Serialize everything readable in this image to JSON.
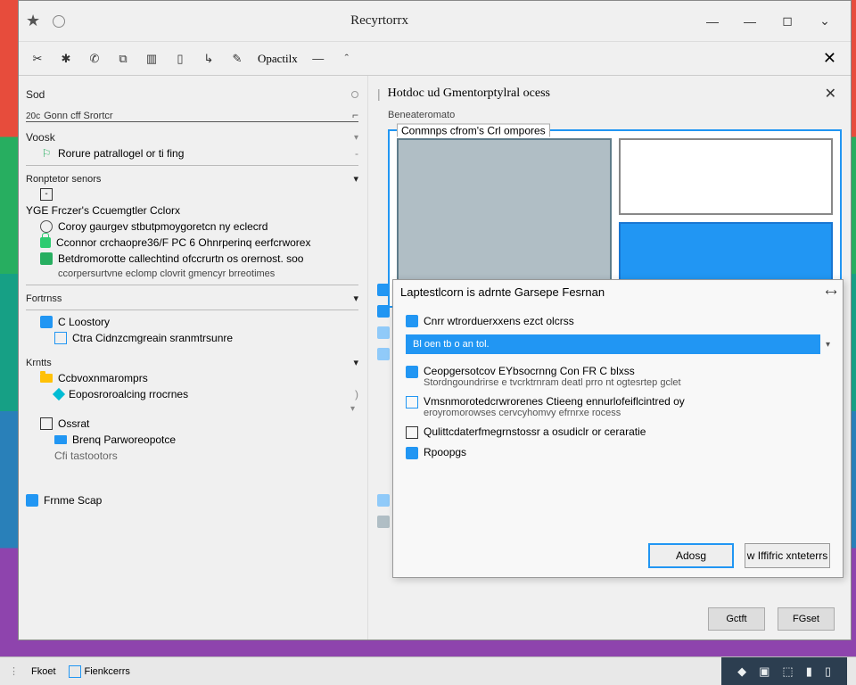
{
  "titlebar": {
    "app_title": "Recyrtorrx"
  },
  "toolbar": {
    "opacity_label": "Opactilx"
  },
  "left": {
    "sod_label": "Sod",
    "stortor_prefix": "20c",
    "stortor_label": "Gonn cff Srortcr",
    "voosk_label": "Voosk",
    "rorure_label": "Rorure patrallogel or ti fing",
    "ronpitor_senors": "Ronptetor senors",
    "yge_title": "YGE Frczer's Ccuemgtler Cclorx",
    "yge1": "Coroy gaurgev stbutpmoygoretcn ny eclecrd",
    "yge2": "Cconnor crchaopre36/F PC 6 Ohnrperinq eerfcrworex",
    "yge3": "Betdromorotte callechtind ofccrurtn os orernost. soo",
    "yge4": "ccorpersurtvne eclomp clovrit gmencyr brreotimes",
    "fortnss": "Fortrnss",
    "c_loostorq": "C Loostory",
    "ctra_cfn": "Ctra Cidnzcmgreain sranmtrsunre",
    "krntts": "Krntts",
    "ccbvox": "Ccbvoxnmaromprs",
    "eopsrt": "Eoposroroalcing rrocrnes",
    "ospat": "Ossrat",
    "brenq": "Brenq Parworeopotce",
    "cfi": "Cfi tastootors",
    "frnme": "Frnme Scap"
  },
  "right": {
    "title": "Hotdoc ud Gmentorptylral ocess",
    "subtitle": "Beneateromato",
    "canvas_title": "Conmnps cfrom's Crl ompores"
  },
  "dialog": {
    "title": "Laptestlcorn is adrnte Garsepe Fesrnan",
    "row1": "Cnrr wtrorduerxxens ezct olcrss",
    "input_value": "Bl oen tb o an tol.",
    "opt1_a": "Ceopgersotcov EYbsocrnng Con FR C blxss",
    "opt1_b": "Stordngoundrirse e tvcrktrnram deatl prro nt ogtesrtep gclet",
    "opt2_a": "Vmsnmorotedcrwrorenes Ctieeng ennurlofeiflcintred oy",
    "opt2_b": "eroyromorowses cervcyhomvy efrnrxe rocess",
    "opt3": "Qulittcdaterfmegrnstossr a osudiclr or ceraratie",
    "opt4": "Rpoopgs",
    "btn_primary": "Adosg",
    "btn_secondary": "w Iffifric xnteterrs"
  },
  "bottom": {
    "confirm": "Gctft",
    "cancel": "FGset"
  },
  "taskbar": {
    "item1": "Fkoet",
    "item2": "Fienkcerrs"
  }
}
